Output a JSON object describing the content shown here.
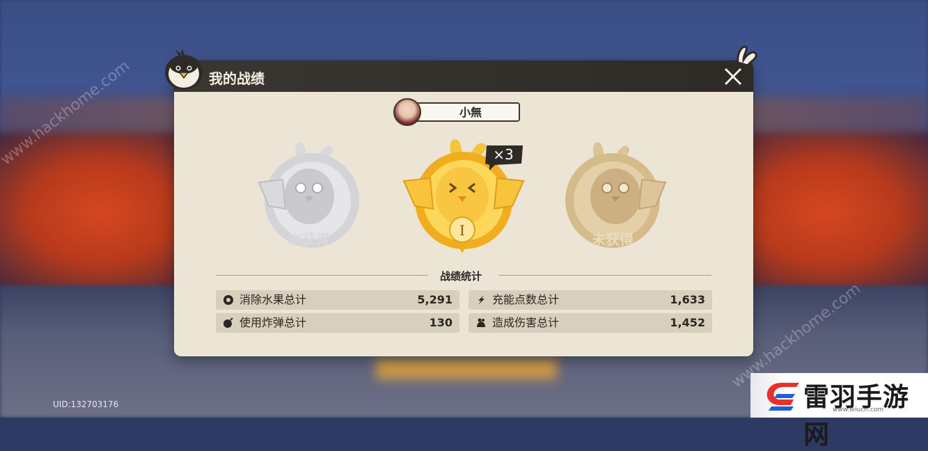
{
  "window": {
    "title": "我的战绩"
  },
  "player": {
    "name": "小無"
  },
  "medals": [
    {
      "tier": "silver",
      "status_label": "未获得",
      "rank": ""
    },
    {
      "tier": "gold",
      "status_label": "",
      "rank": "I",
      "count_badge": "×3"
    },
    {
      "tier": "bronze",
      "status_label": "未获得",
      "rank": ""
    }
  ],
  "stats": {
    "section_title": "战绩统计",
    "items": [
      {
        "icon": "fruit-icon",
        "label": "消除水果总计",
        "value": "5,291"
      },
      {
        "icon": "energy-icon",
        "label": "充能点数总计",
        "value": "1,633"
      },
      {
        "icon": "bomb-icon",
        "label": "使用炸弹总计",
        "value": "130"
      },
      {
        "icon": "damage-icon",
        "label": "造成伤害总计",
        "value": "1,452"
      }
    ]
  },
  "footer": {
    "uid": "UID:132703176"
  },
  "watermarks": {
    "site": "www.hackhome.com"
  },
  "brand": {
    "name": "雷羽手游网",
    "url": "www.leiucn.com"
  },
  "colors": {
    "header_bg": "#2e2a26",
    "panel_bg": "#ece4d5",
    "stat_row_bg": "#d9cfbd",
    "gold": "#f2b62a",
    "silver": "#b9b9be",
    "bronze": "#c9ab7a"
  }
}
